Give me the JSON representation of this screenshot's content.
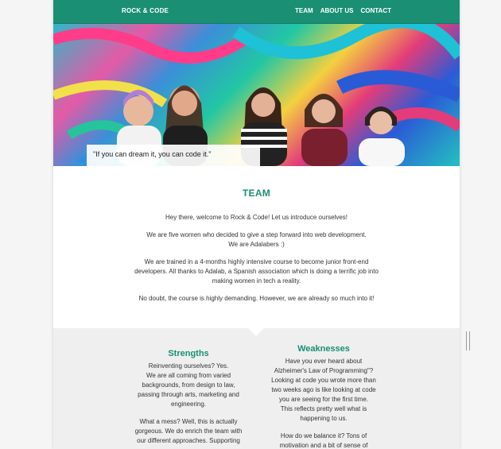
{
  "navbar": {
    "brand": "ROCK & CODE",
    "links": [
      "TEAM",
      "ABOUT US",
      "CONTACT"
    ],
    "color": "#1a8f74"
  },
  "hero": {
    "quote": "\"If you can dream it, you can code it.\""
  },
  "team": {
    "title": "TEAM",
    "paragraphs": [
      "Hey there, welcome to Rock & Code! Let us introduce ourselves!",
      "We are five women who decided to give a step forward into web development.",
      "We are Adalabers :)",
      "We are trained in a 4-months highly intensive course to become junior front-end",
      "developers. All thanks to Adalab, a Spanish association which is doing a terrific job into",
      "making women in tech a reality.",
      "No doubt, the course is highly demanding. However, we are already so much into it!"
    ]
  },
  "strengths": {
    "title": "Strengths",
    "lines1": [
      "Reinventing ourselves? Yes.",
      "We are all coming from varied",
      "backgrounds, from design to law,",
      "passing through arts, marketing and",
      "engineering."
    ],
    "lines2": [
      "What a mess? Well, this is actually",
      "gorgeous. We do enrich the team with",
      "our different approaches. Supporting"
    ]
  },
  "weaknesses": {
    "title": "Weaknesses",
    "lines1": [
      "Have you ever heard about",
      "Alzheimer's Law of Programming\"?",
      "Looking at code you wrote more than",
      "two weeks ago is like looking at code",
      "you are seeing for the first time.",
      "This reflects pretty well what is",
      "happening to us."
    ],
    "lines2": [
      "How do we balance it? Tons of",
      "motivation and a bit of sense of"
    ]
  }
}
